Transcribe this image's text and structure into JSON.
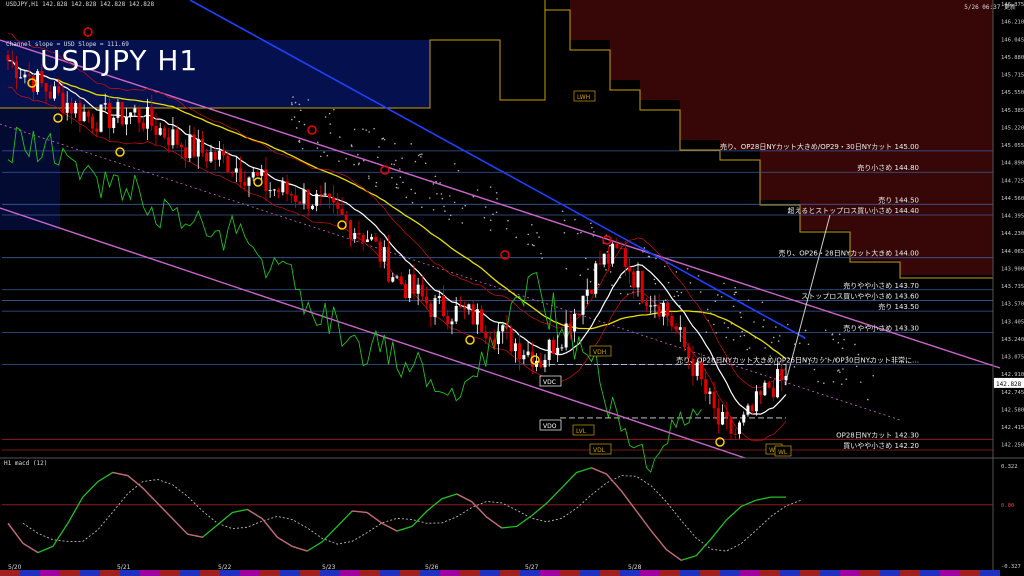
{
  "header": {
    "symbol_line": "USDJPY,H1  142.828 142.828 142.828 142.828",
    "channel_line": "Channel slope = USD Slope = 111.69",
    "title": "USDJPY H1",
    "timestamp": "5/26 06:37 更新",
    "macd_label": "H1  macd (12)"
  },
  "colors": {
    "background": "#000000",
    "bull": "#ffffff",
    "bear": "#e00000",
    "channel": "#cc66cc",
    "sma_fast": "#ffffff",
    "sma_slow": "#e8e000",
    "trend_blue": "#2040ff",
    "cloud_dot": "#b0b0b0",
    "hline": "#3a5aa0",
    "ichimoku_red": "#7a1010",
    "ichimoku_blue": "#0a1f90",
    "chikou": "#20c020",
    "envelope": "#cc1010",
    "macd": "#20c020",
    "signal": "#bbbbbb"
  },
  "chart_data": {
    "type": "line",
    "title": "USDJPY H1",
    "ylim": [
      142.125,
      146.375
    ],
    "y_ticks": [
      "146.375",
      "146.210",
      "146.045",
      "145.880",
      "145.715",
      "145.550",
      "145.385",
      "145.220",
      "145.055",
      "144.890",
      "144.725",
      "144.560",
      "144.395",
      "144.230",
      "144.065",
      "143.900",
      "143.735",
      "143.570",
      "143.405",
      "143.240",
      "143.075",
      "142.910",
      "142.828",
      "142.745",
      "142.580",
      "142.415",
      "142.250"
    ],
    "current_price": "142.828",
    "x_labels": [
      "5/20",
      "5/21",
      "5/22",
      "5/23",
      "5/26",
      "5/27",
      "5/28"
    ],
    "sell_orders": [
      {
        "price": 145.0,
        "label": "売り、OP28日NYカット大きめ/OP29・30日NYカット 145.00"
      },
      {
        "price": 144.8,
        "label": "売り小さめ 144.80"
      },
      {
        "price": 144.5,
        "label": "売り 144.50"
      },
      {
        "price": 144.4,
        "label": "超えるとストップロス買い小さめ 144.40"
      },
      {
        "price": 144.0,
        "label": "売り、OP26・28日NYカット大きめ 144.00"
      },
      {
        "price": 143.7,
        "label": "売りやや小さめ 143.70"
      },
      {
        "price": 143.6,
        "label": "ストップロス買いやや小さめ 143.60"
      },
      {
        "price": 143.5,
        "label": "売り 143.50"
      },
      {
        "price": 143.3,
        "label": "売りやや小さめ 143.30"
      },
      {
        "price": 143.0,
        "label": "売り、OP28日NYカット大きめ/OP26日NYカット/OP30日NYカット非常に…"
      },
      {
        "price": 142.3,
        "label": "OP28日NYカット 142.30"
      },
      {
        "price": 142.2,
        "label": "買いやや小さめ 142.20"
      }
    ],
    "level_tags": [
      "LWH",
      "VDH",
      "VDC",
      "VDO",
      "LVL",
      "VDL",
      "WH",
      "WL"
    ],
    "macd": {
      "ylim": [
        -0.327,
        0.322
      ],
      "y_ticks": [
        "0.322",
        "0.00",
        "-0.327"
      ],
      "values": [
        -0.05,
        -0.18,
        -0.24,
        -0.2,
        -0.05,
        0.12,
        0.22,
        0.28,
        0.26,
        0.18,
        0.08,
        -0.02,
        -0.12,
        -0.14,
        -0.06,
        0.02,
        0.04,
        -0.02,
        -0.14,
        -0.2,
        -0.23,
        -0.17,
        -0.07,
        0.03,
        0.02,
        -0.05,
        -0.1,
        -0.07,
        0.03,
        0.11,
        0.14,
        0.09,
        -0.01,
        -0.08,
        -0.07,
        0.0,
        0.08,
        0.18,
        0.28,
        0.31,
        0.27,
        0.16,
        0.03,
        -0.1,
        -0.22,
        -0.29,
        -0.26,
        -0.15,
        -0.03,
        0.06,
        0.1,
        0.12,
        0.12
      ]
    }
  }
}
